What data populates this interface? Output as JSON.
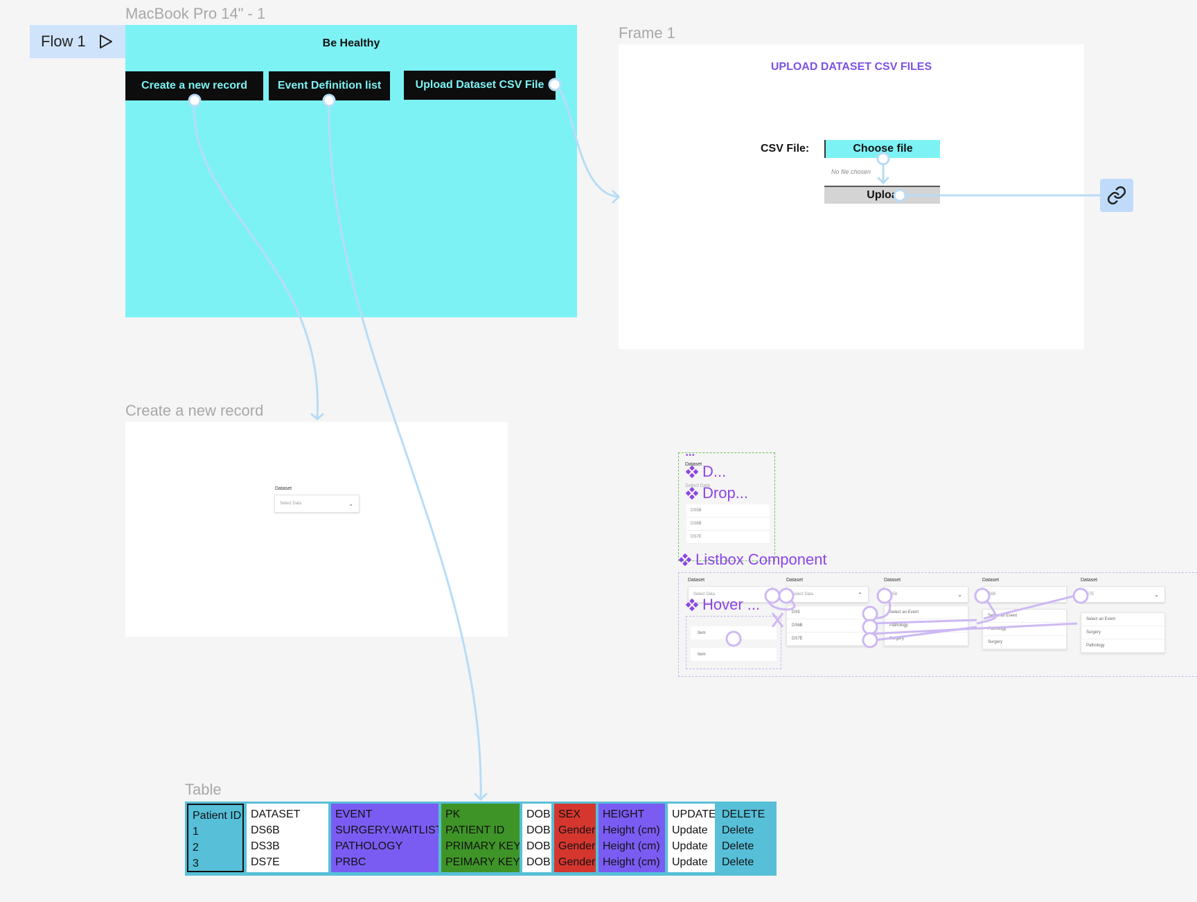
{
  "canvas": {
    "flow_badge": {
      "label": "Flow 1",
      "icon": "play-icon"
    },
    "frames": {
      "macbook": {
        "label": "MacBook Pro 14\" - 1",
        "title": "Be Healthy",
        "buttons": [
          "Create a new record",
          "Event Definition list",
          "Upload Dataset CSV File"
        ],
        "bg_color": "#7df2f4"
      },
      "frame1": {
        "label": "Frame 1",
        "heading": "UPLOAD DATASET CSV FILES",
        "csv_label": "CSV File:",
        "choose_file": "Choose file",
        "no_file": "No file chosen",
        "upload_btn": "Uploa",
        "link_icon": "link-icon"
      },
      "create_record": {
        "label": "Create a new record",
        "field_label": "Dataset",
        "select_placeholder": "Select Data"
      },
      "components": {
        "dots": "•••",
        "dataset_label": "Dataset",
        "select_data": "Select Data",
        "items": [
          "D...",
          "Drop..."
        ],
        "list_rows": [
          "DS5B",
          "DS6B",
          "DS7E"
        ],
        "listbox_title": "Listbox Component",
        "hover_label": "Hover ...",
        "hover_items": [
          "Item",
          "Item"
        ],
        "variants": [
          {
            "label": "Dataset",
            "value": "Select Data",
            "options": []
          },
          {
            "label": "Dataset",
            "value": "Select Data",
            "options": [
              "DS5",
              "DS6B",
              "DS7E"
            ]
          },
          {
            "label": "Dataset",
            "value": "S5B",
            "options": [
              "Select an Event",
              "Pathology",
              "Surgery"
            ]
          },
          {
            "label": "Dataset",
            "value": "S6B",
            "options": [
              "Select an Event",
              "Pathology",
              "Surgery"
            ]
          },
          {
            "label": "Dataset",
            "value": "S7E",
            "options": [
              "Select an Event",
              "Surgery",
              "Pathology"
            ]
          }
        ]
      },
      "table": {
        "label": "Table",
        "columns": [
          {
            "header": "Patient ID",
            "rows": [
              "1",
              "2",
              "3"
            ],
            "color": "#57bfd8"
          },
          {
            "header": "DATASET",
            "rows": [
              "DS6B",
              "DS3B",
              "DS7E"
            ],
            "color": "#ffffff"
          },
          {
            "header": "EVENT",
            "rows": [
              "SURGERY.WAITLIST",
              "PATHOLOGY",
              "PRBC"
            ],
            "color": "#7b5cf3"
          },
          {
            "header": "PK",
            "rows": [
              "PATIENT ID",
              "PRIMARY KEY",
              "PEIMARY KEY"
            ],
            "color": "#3f9428"
          },
          {
            "header": "DOB",
            "rows": [
              "DOB",
              "DOB",
              "DOB"
            ],
            "color": "#ffffff"
          },
          {
            "header": "SEX",
            "rows": [
              "Gender",
              "Gender",
              "Gender"
            ],
            "color": "#d5362e"
          },
          {
            "header": "HEIGHT",
            "rows": [
              "Height (cm)",
              "Height (cm)",
              "Height (cm)"
            ],
            "color": "#7b5cf3"
          },
          {
            "header": "UPDATE",
            "rows": [
              "Update",
              "Update",
              "Update"
            ],
            "color": "#ffffff"
          },
          {
            "header": "DELETE",
            "rows": [
              "Delete",
              "Delete",
              "Delete"
            ],
            "color": "#57bfd8"
          }
        ]
      }
    },
    "colors": {
      "connector": "#b8dcf6",
      "component": "#8b45e6",
      "canvas_bg": "#f5f5f5"
    }
  }
}
